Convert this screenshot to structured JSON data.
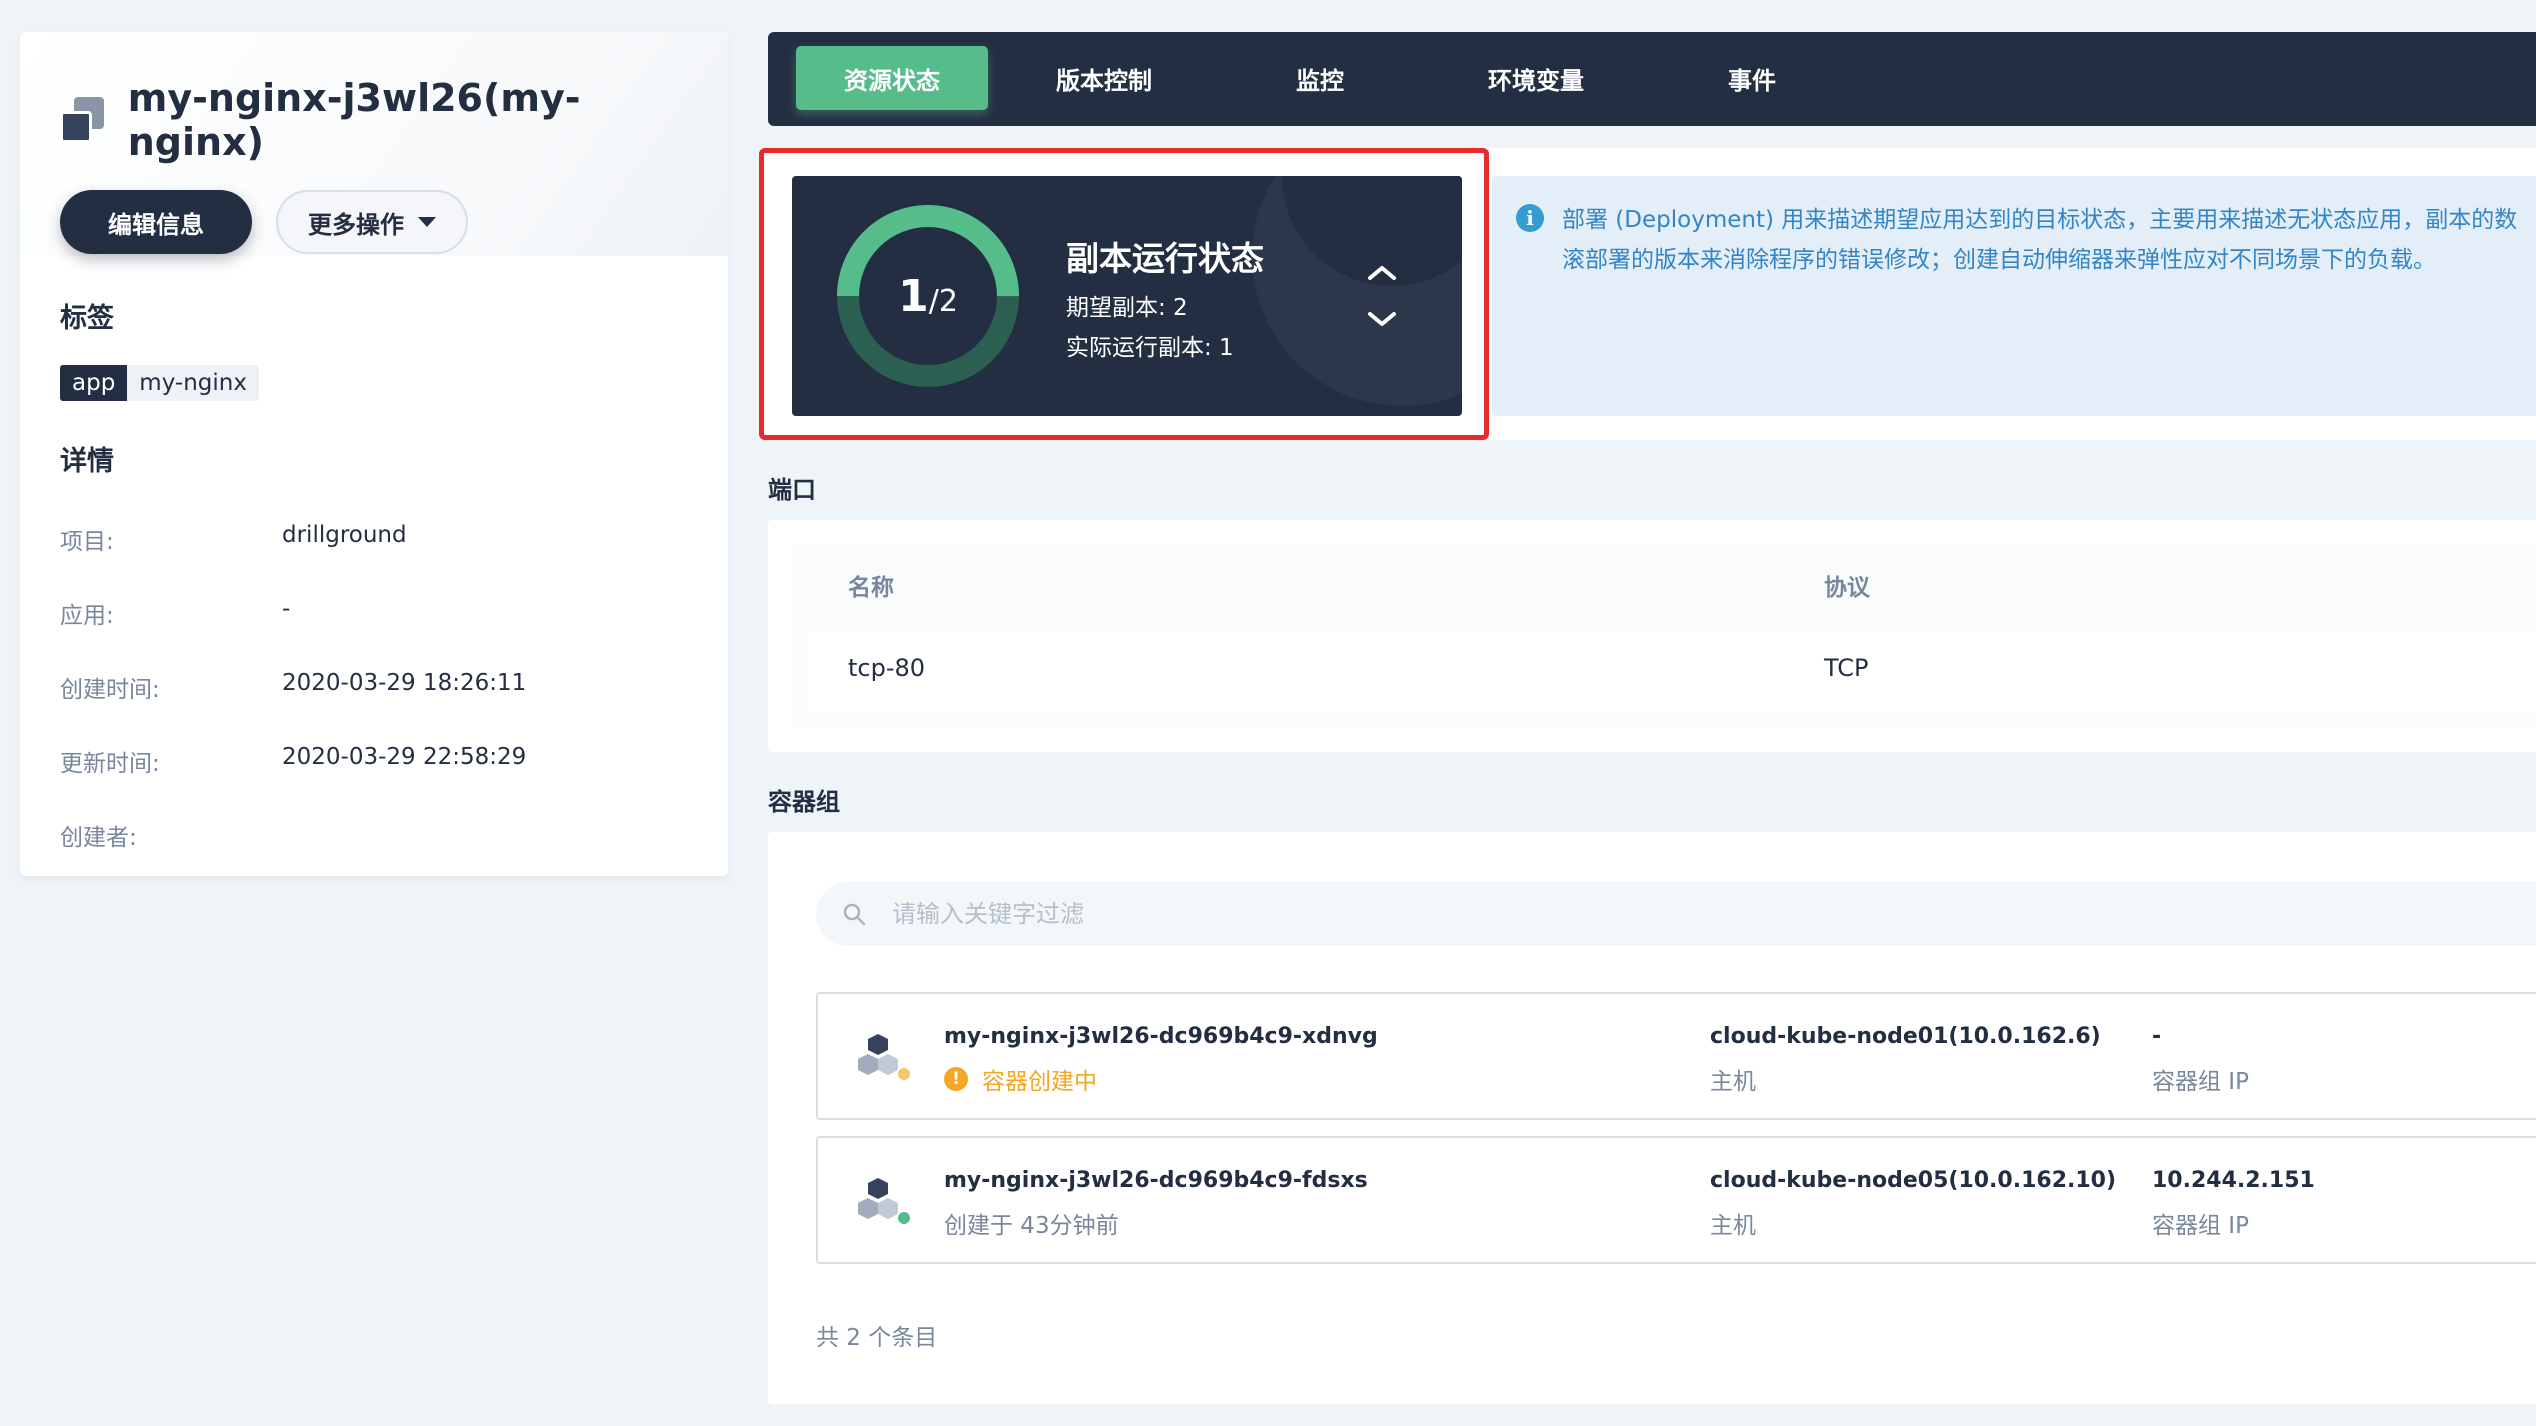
{
  "header": {
    "title": "my-nginx-j3wl26(my-nginx)",
    "edit_button": "编辑信息",
    "more_button": "更多操作"
  },
  "labels": {
    "title": "标签",
    "key": "app",
    "value": "my-nginx"
  },
  "details": {
    "title": "详情",
    "rows": [
      {
        "key": "项目:",
        "value": "drillground"
      },
      {
        "key": "应用:",
        "value": "-"
      },
      {
        "key": "创建时间:",
        "value": "2020-03-29 18:26:11"
      },
      {
        "key": "更新时间:",
        "value": "2020-03-29 22:58:29"
      },
      {
        "key": "创建者:",
        "value": ""
      }
    ]
  },
  "tabs": [
    {
      "label": "资源状态",
      "active": true
    },
    {
      "label": "版本控制",
      "active": false
    },
    {
      "label": "监控",
      "active": false
    },
    {
      "label": "环境变量",
      "active": false
    },
    {
      "label": "事件",
      "active": false
    }
  ],
  "replica_status": {
    "title": "副本运行状态",
    "running": "1",
    "desired": "2",
    "desired_line": "期望副本: 2",
    "actual_line": "实际运行副本: 1",
    "ring_color": "#55bc8a",
    "ring_track_color": "#2b5f52"
  },
  "info": {
    "line1": "部署 (Deployment) 用来描述期望应用达到的目标状态，主要用来描述无状态应用，副本的数",
    "line2": "滚部署的版本来消除程序的错误修改；创建自动伸缩器来弹性应对不同场景下的负载。"
  },
  "ports": {
    "section_title": "端口",
    "columns": [
      "名称",
      "协议"
    ],
    "rows": [
      {
        "name": "tcp-80",
        "protocol": "TCP"
      }
    ]
  },
  "pods": {
    "section_title": "容器组",
    "search_placeholder": "请输入关键字过滤",
    "items": [
      {
        "name": "my-nginx-j3wl26-dc969b4c9-xdnvg",
        "status": "容器创建中",
        "status_kind": "warning",
        "node": "cloud-kube-node01(10.0.162.6)",
        "node_label": "主机",
        "ip": "-",
        "ip_label": "容器组 IP"
      },
      {
        "name": "my-nginx-j3wl26-dc969b4c9-fdsxs",
        "status": "创建于 43分钟前",
        "status_kind": "running",
        "node": "cloud-kube-node05(10.0.162.10)",
        "node_label": "主机",
        "ip": "10.244.2.151",
        "ip_label": "容器组 IP"
      }
    ],
    "total": "共 2 个条目"
  },
  "colors": {
    "accent_green": "#55bc8a",
    "warning": "#f5a623",
    "highlight_red": "#e72b2b",
    "dark": "#242e42"
  }
}
